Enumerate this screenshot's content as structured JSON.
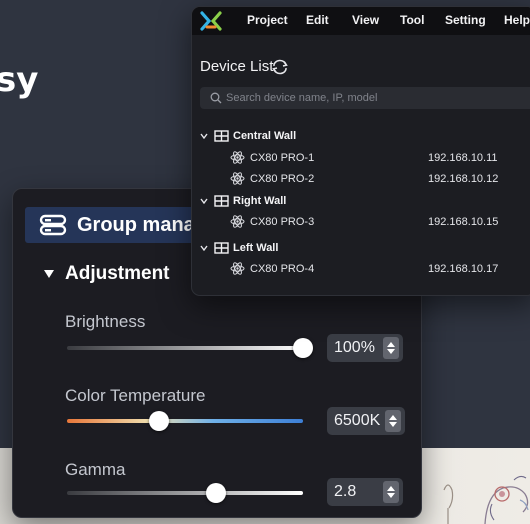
{
  "background": {
    "headline": "sy"
  },
  "window": {
    "menu": [
      "Project",
      "Edit",
      "View",
      "Tool",
      "Setting",
      "Help"
    ],
    "device_list_title": "Device List",
    "search": {
      "placeholder": "Search device name, IP, model",
      "value": ""
    },
    "groups": [
      {
        "name": "Central Wall",
        "devices": [
          {
            "name": "CX80 PRO-1",
            "ip": "192.168.10.11"
          },
          {
            "name": "CX80 PRO-2",
            "ip": "192.168.10.12"
          }
        ]
      },
      {
        "name": "Right Wall",
        "devices": [
          {
            "name": "CX80 PRO-3",
            "ip": "192.168.10.15"
          }
        ]
      },
      {
        "name": "Left Wall",
        "devices": [
          {
            "name": "CX80 PRO-4",
            "ip": "192.168.10.17"
          }
        ]
      }
    ]
  },
  "panel": {
    "title": "Group manag",
    "section": "Adjustment",
    "controls": {
      "brightness": {
        "label": "Brightness",
        "value": "100%",
        "fraction": 1.0
      },
      "color_temperature": {
        "label": "Color Temperature",
        "value": "6500K",
        "fraction": 0.39
      },
      "gamma": {
        "label": "Gamma",
        "value": "2.8",
        "fraction": 0.63
      }
    }
  },
  "colors": {
    "accent_header": "#253558",
    "temperature_warm": "#e8773a",
    "temperature_mid": "#f0e0b0",
    "temperature_cool": "#3d7fd6"
  }
}
